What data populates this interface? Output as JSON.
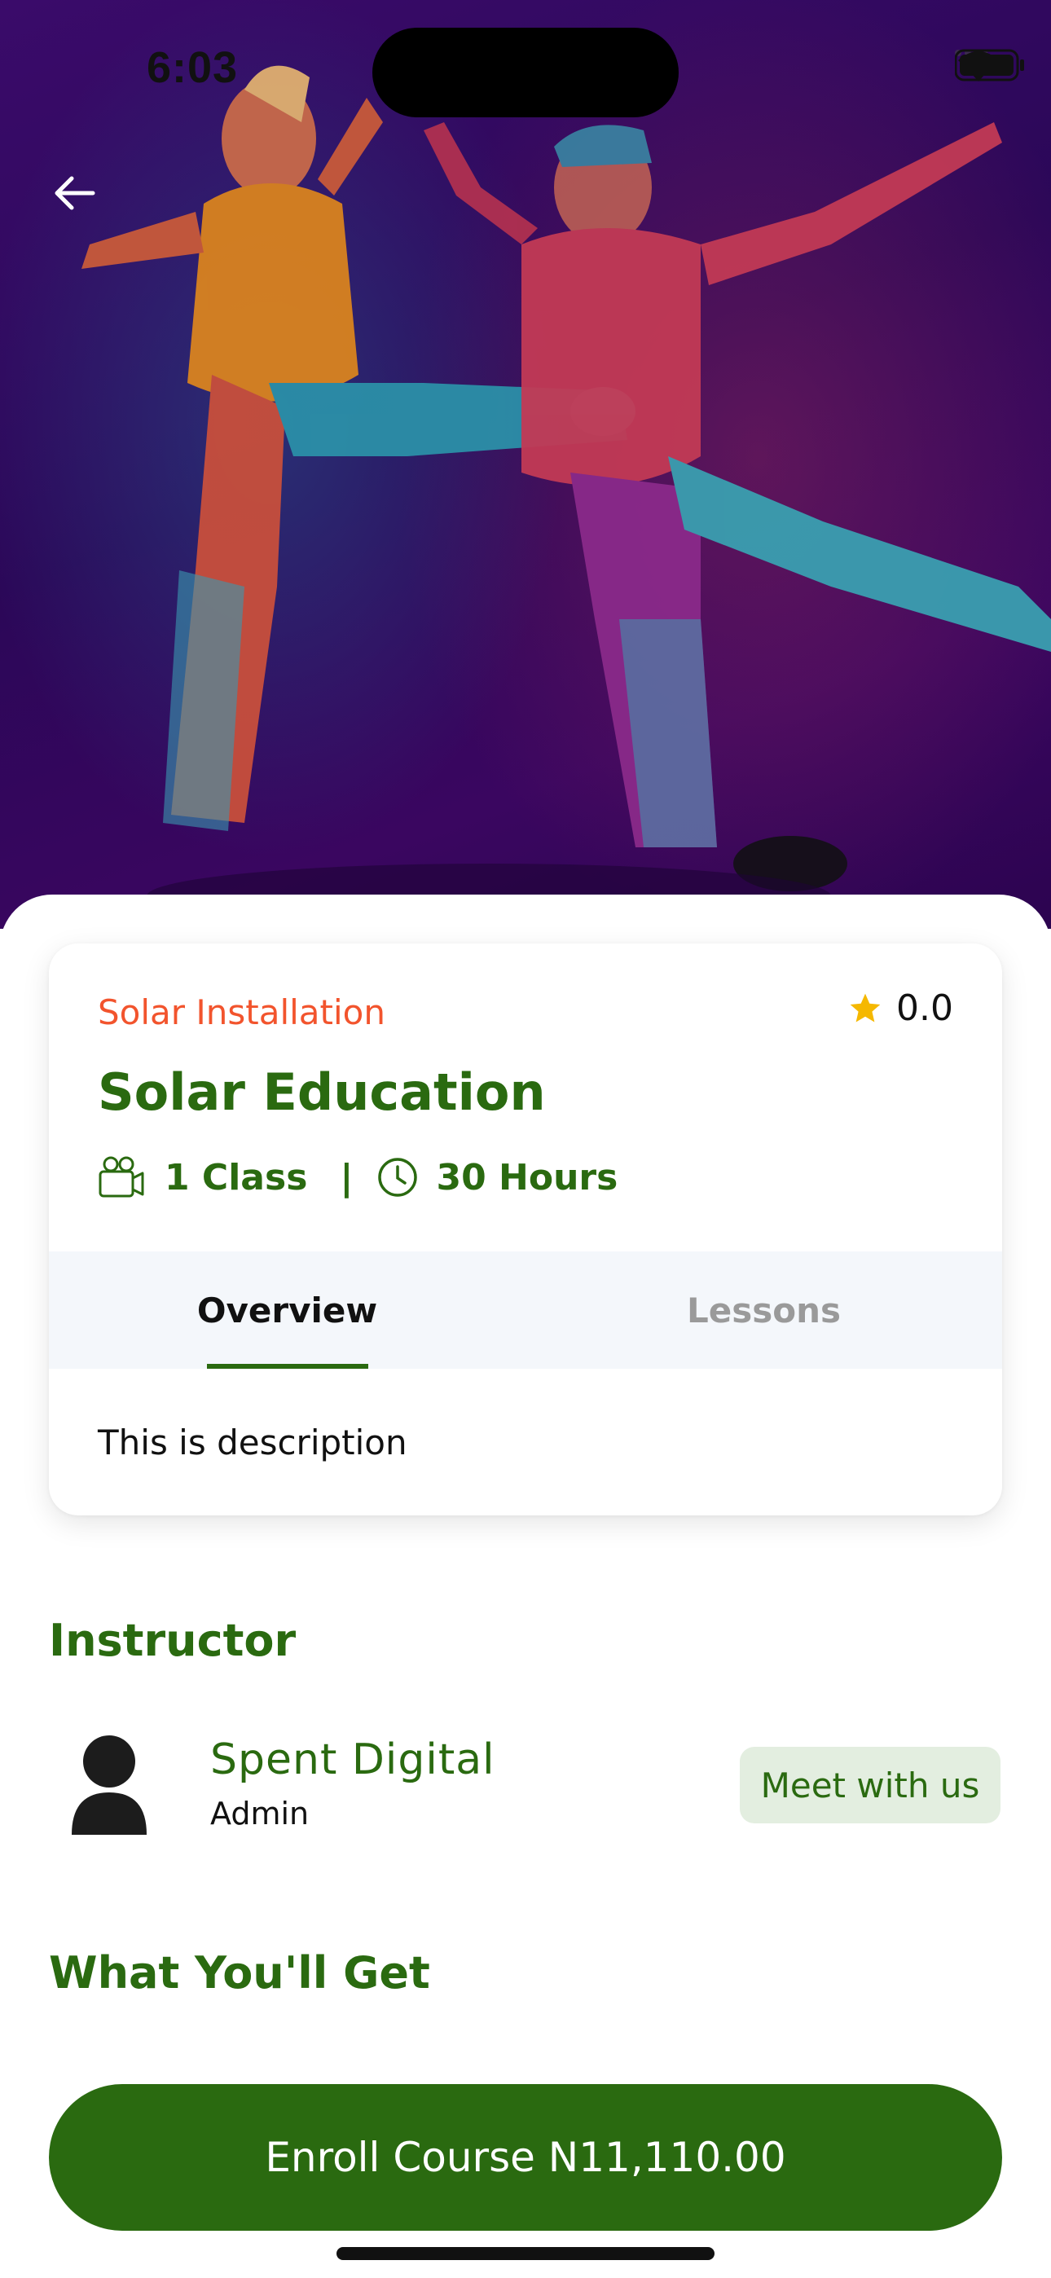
{
  "status_bar": {
    "time": "6:03"
  },
  "hero": {
    "image": "Two dancers mid-dance on a purple background",
    "back_icon": "arrow-left-icon"
  },
  "course": {
    "category": "Solar Installation",
    "rating": "0.0",
    "title": "Solar Education",
    "classes": "1 Class",
    "separator": "|",
    "duration": "30 Hours",
    "description": "This is description"
  },
  "tabs": [
    {
      "label": "Overview",
      "active": true
    },
    {
      "label": "Lessons",
      "active": false
    }
  ],
  "instructor": {
    "heading": "Instructor",
    "name": "Spent Digital",
    "role": "Admin",
    "meet_label": "Meet with us"
  },
  "what_youll_get": {
    "heading": "What You'll Get"
  },
  "enroll": {
    "label": "Enroll Course N11,110.00"
  },
  "colors": {
    "brand_green": "#2a6a10",
    "category_orange": "#f2542d",
    "star_yellow": "#f5b800",
    "tab_bg": "#f4f7fb",
    "meet_bg": "#e3eee0"
  }
}
